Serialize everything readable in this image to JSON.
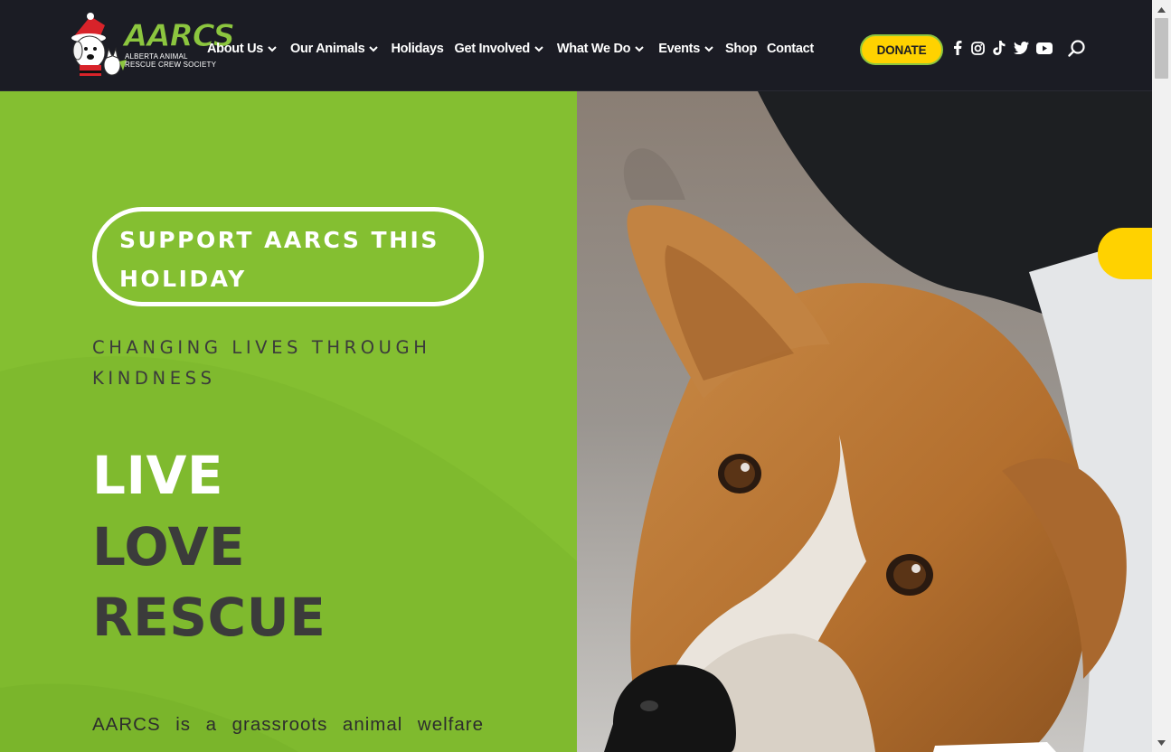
{
  "header": {
    "logo": {
      "name": "AARCS",
      "line1": "ALBERTA ANIMAL",
      "line2": "RESCUE CREW SOCIETY"
    },
    "nav": [
      {
        "label": "About Us",
        "has_dropdown": true
      },
      {
        "label": "Our Animals",
        "has_dropdown": true
      },
      {
        "label": "Holidays",
        "has_dropdown": false
      },
      {
        "label": "Get Involved",
        "has_dropdown": true
      },
      {
        "label": "What We Do",
        "has_dropdown": true
      },
      {
        "label": "Events",
        "has_dropdown": true
      },
      {
        "label": "Shop",
        "has_dropdown": false
      },
      {
        "label": "Contact",
        "has_dropdown": false
      }
    ],
    "donate_label": "DONATE",
    "social_icons": [
      "facebook-icon",
      "instagram-icon",
      "tiktok-icon",
      "twitter-icon",
      "youtube-icon"
    ],
    "search_icon": "search-icon"
  },
  "hero": {
    "support_button": "SUPPORT AARCS THIS HOLIDAY",
    "tagline": "CHANGING LIVES THROUGH KINDNESS",
    "words": [
      "LIVE",
      "LOVE",
      "RESCUE"
    ],
    "intro": "AARCS is a grassroots animal welfare",
    "photo": "dog-photo"
  },
  "colors": {
    "header_bg": "#1b1c24",
    "brand_green": "#84bf31",
    "accent_yellow": "#ffd200",
    "dark_text": "#3b3b3b"
  }
}
